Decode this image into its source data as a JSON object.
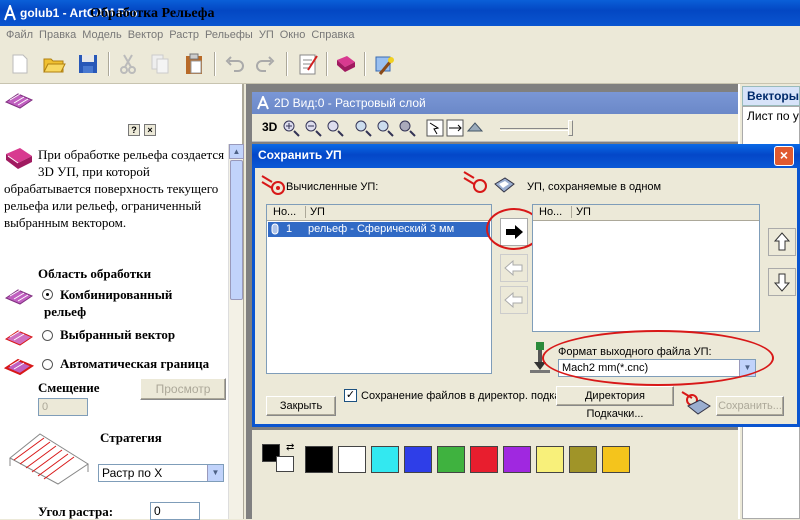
{
  "window": {
    "title": "golub1 - ArtCAM Pro"
  },
  "menu": [
    "Файл",
    "Правка",
    "Модель",
    "Вектор",
    "Растр",
    "Рельефы",
    "УП",
    "Окно",
    "Справка"
  ],
  "toolbar": {
    "icons": [
      "new-file-icon",
      "open-folder-icon",
      "save-icon",
      "cut-icon",
      "copy-icon",
      "paste-icon",
      "undo-icon",
      "redo-icon",
      "notes-icon",
      "book-icon",
      "wizard-icon"
    ]
  },
  "left_panel": {
    "title": "Обработка Рельефа",
    "help_button": "?",
    "close_button": "×",
    "description": "При обработке рельефа создается 3D УП, при которой обрабатывается поверхность текущего рельефа или рельеф, ограниченный выбранным вектором.",
    "area_label": "Область обработки",
    "options": [
      {
        "label": "Комбинированный рельеф",
        "selected": true
      },
      {
        "label": "Выбранный вектор",
        "selected": false
      },
      {
        "label": "Автоматическая граница",
        "selected": false
      }
    ],
    "offset_label": "Смещение",
    "offset_value": "0",
    "preview_button": "Просмотр",
    "strategy_label": "Стратегия",
    "strategy_value": "Растр по X",
    "angle_label": "Угол растра:",
    "angle_value": "0"
  },
  "view_window": {
    "title": "2D Вид:0 - Растровый слой",
    "mode_label": "3D"
  },
  "right_panel": {
    "header": "Векторы",
    "line": "Лист по у"
  },
  "dialog": {
    "title": "Сохранить УП",
    "close": "×",
    "computed_label": "Вычисленные УП:",
    "saved_label": "УП, сохраняемые в одном",
    "col_no": "Но...",
    "col_up": "УП",
    "rows": [
      {
        "no": "1",
        "name": "рельеф - Сферический 3 мм"
      }
    ],
    "format_label": "Формат выходного файла УП:",
    "format_value": "Mach2 mm(*.cnc)",
    "close_button": "Закрыть",
    "save_to_dir_label": "Сохранение файлов в директор. подкачки",
    "save_to_dir_checked": true,
    "dir_button": "Директория Подкачки...",
    "save_button": "Сохранить..."
  },
  "palette": {
    "colors": [
      "#000000",
      "#ffffff",
      "#33e8f0",
      "#2e3ee8",
      "#3fb23f",
      "#e81e2e",
      "#a028e0",
      "#f8f07a",
      "#a09428",
      "#f4c41c"
    ]
  },
  "colors": {
    "titlebar": "#0a55d0",
    "highlight": "#d81818",
    "selection": "#316ac5"
  }
}
